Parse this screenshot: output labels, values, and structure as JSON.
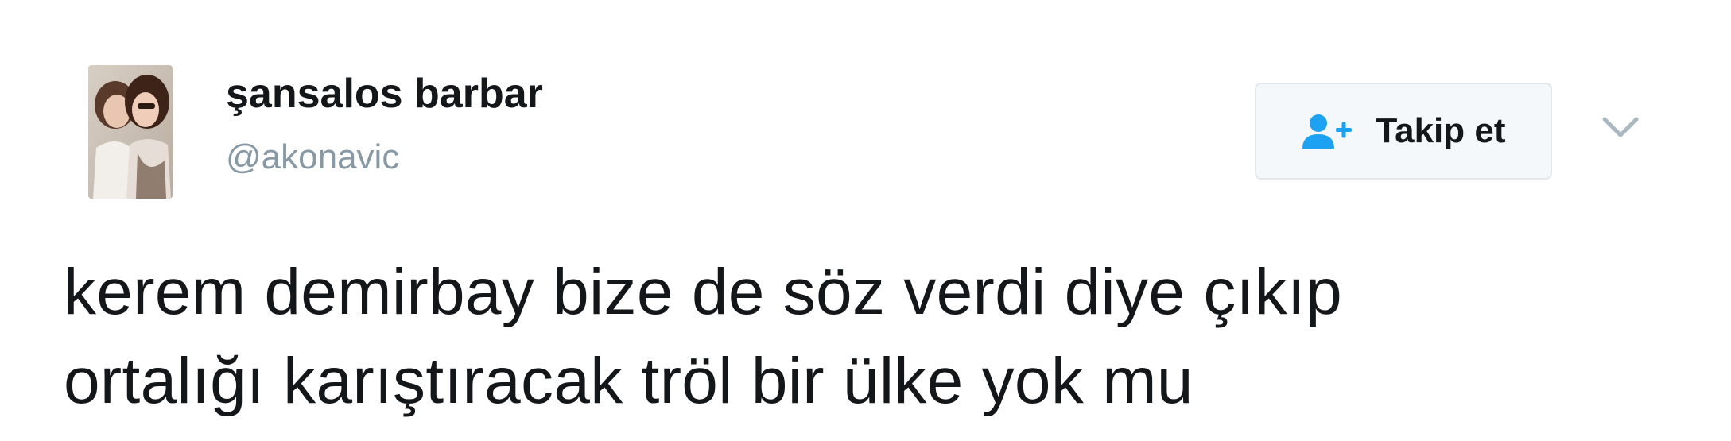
{
  "tweet": {
    "author": {
      "display_name": "şansalos barbar",
      "handle": "@akonavic",
      "avatar_icon": "profile-photo"
    },
    "follow_button": {
      "label": "Takip et",
      "icon": "add-user-icon"
    },
    "menu_icon": "chevron-down-icon",
    "text_lines": [
      "kerem demirbay bize de söz verdi diye çıkıp",
      "ortalığı karıştıracak tröl bir ülke yok mu"
    ]
  },
  "colors": {
    "text": "#14171a",
    "secondary_text": "#8899a6",
    "accent": "#1da1f2",
    "button_bg": "#f5f8fa",
    "button_border": "#e1e8ed"
  }
}
